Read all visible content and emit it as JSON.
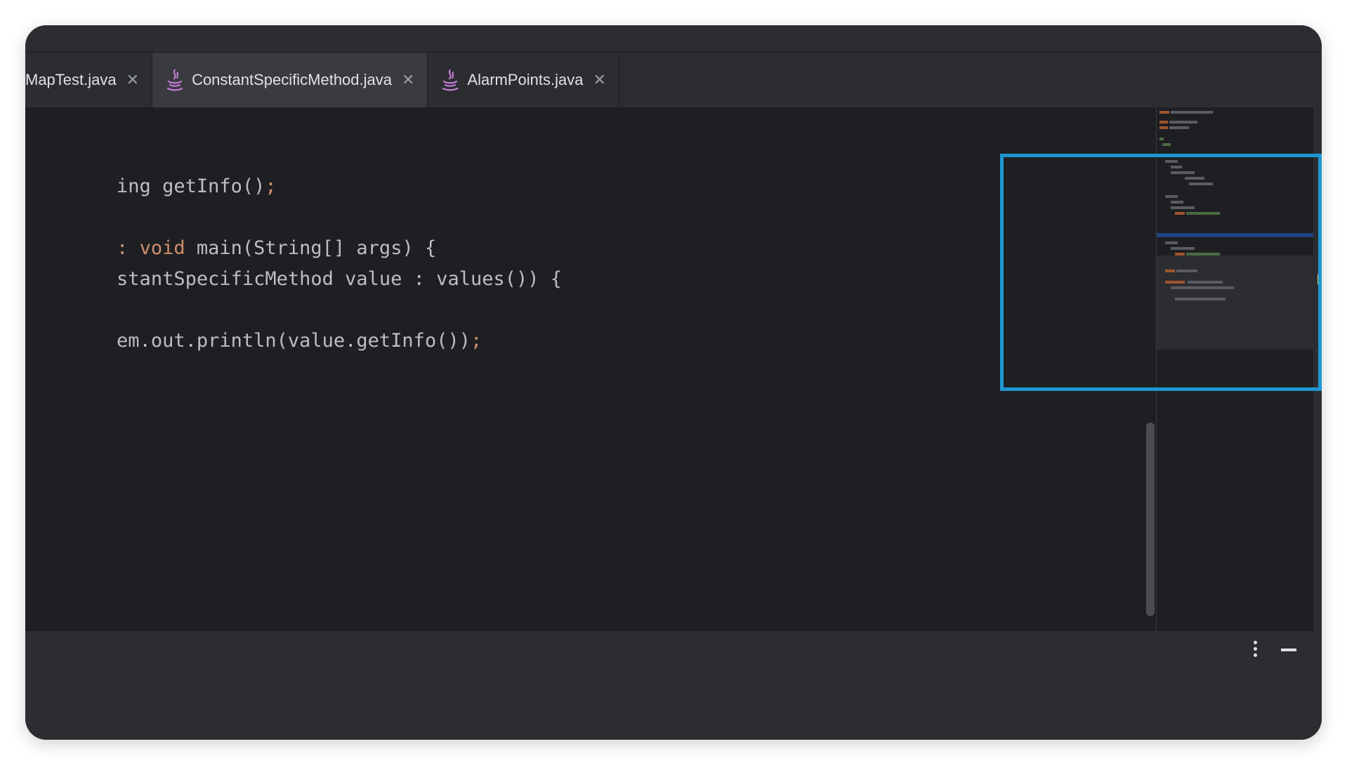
{
  "tabs": [
    {
      "label": "MapTest.java",
      "active": false
    },
    {
      "label": "ConstantSpecificMethod.java",
      "active": true
    },
    {
      "label": "AlarmPoints.java",
      "active": false
    }
  ],
  "code": {
    "line1": {
      "text": "ing getInfo()",
      "semi": ";"
    },
    "line2": {
      "prefix": ": ",
      "keyword": "void",
      "text": " main(String[] args) {"
    },
    "line3": {
      "text": "stantSpecificMethod value : values()) {"
    },
    "line4": {
      "text": "em.out.println(value.getInfo())",
      "semi": ";"
    }
  },
  "icons": {
    "tab_file": "java-file-icon",
    "tab_close": "close-icon",
    "more": "more-vertical-icon",
    "minimize": "minimize-icon"
  },
  "colors": {
    "highlight": "#1e96d2",
    "keyword": "#cf8e6d",
    "text": "#bcbec4",
    "editor_bg": "#1e1f22"
  }
}
